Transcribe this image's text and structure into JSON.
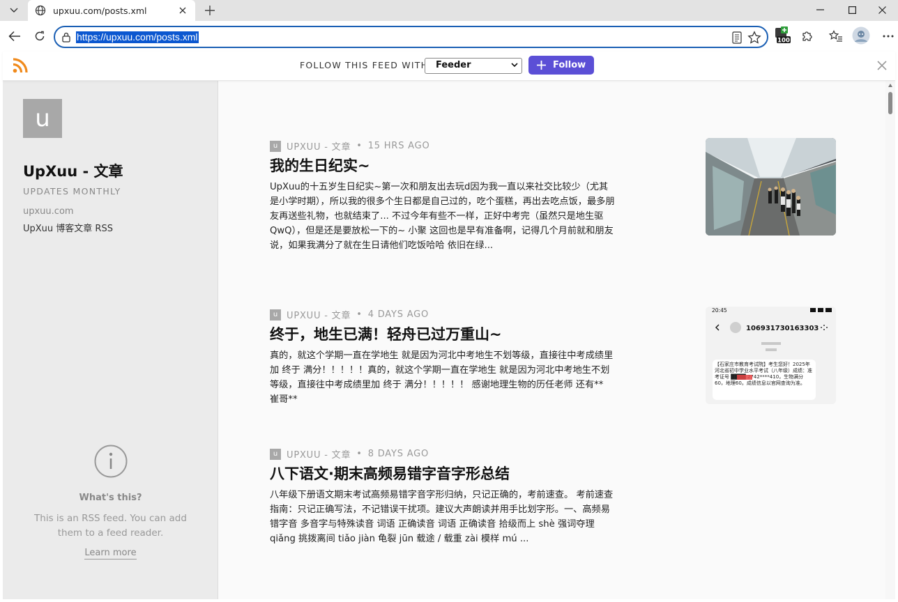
{
  "browser": {
    "tab_title": "upxuu.com/posts.xml",
    "url": "https://upxuu.com/posts.xml",
    "extension_badge": "100"
  },
  "follow_bar": {
    "label": "FOLLOW THIS FEED WITH",
    "selected_reader": "Feeder",
    "follow_label": "Follow",
    "accent": "#5b4fd6"
  },
  "site": {
    "avatar_letter": "u",
    "title": "UpXuu - 文章",
    "updates": "UPDATES MONTHLY",
    "domain": "upxuu.com",
    "description": "UpXuu 博客文章 RSS"
  },
  "info": {
    "icon": "info-icon",
    "title": "What's this?",
    "text": "This is an RSS feed. You can add them to a feed reader.",
    "learn_more": "Learn more"
  },
  "entries": [
    {
      "avatar": "u",
      "source": "UPXUU - 文章",
      "time": "15 HRS AGO",
      "title": "我的生日纪实~",
      "summary": "UpXuu的十五岁生日纪实~第一次和朋友出去玩d因为我一直以来社交比较少（尤其是小学时期），所以我的很多个生日都是自己过的，吃个蛋糕，再出去吃点饭，最多朋友再送些礼物，也就结束了... 不过今年有些不一样，正好中考完（虽然只是地生驱QwQ），但是还是要放松一下的~ 小聚 这回也是早有准备啊，记得几个月前就和朋友说，如果我满分了就在生日请他们吃饭哈哈 依旧在绿..."
    },
    {
      "avatar": "u",
      "source": "UPXUU - 文章",
      "time": "4 DAYS AGO",
      "title": "终于，地生已满！轻舟已过万重山~",
      "summary": "真的，就这个学期一直在学地生 就是因为河北中考地生不划等级，直接往中考成绩里加 终于 满分！！！！！真的，就这个学期一直在学地生 就是因为河北中考地生不划等级，直接往中考成绩里加 终于 满分！！！！！ 感谢地理生物的历任老师 还有** 崔哥**",
      "thumb": {
        "status_time": "20:45",
        "phone_number": "106931730163303",
        "sms_text": "【石家庄市教育考试院】考生您好！2025年河北省初中学业水平考试（八年级）成绩：准考证号 ████ 2742****410，生物满分60，地理60。成绩信息以官网查询为准。"
      }
    },
    {
      "avatar": "u",
      "source": "UPXUU - 文章",
      "time": "8 DAYS AGO",
      "title": "八下语文·期末高频易错字音字形总结",
      "summary": "八年级下册语文期末考试高频易错字音字形归纳，只记正确的，考前速查。 考前速查指南：只记正确写法，不记错误干扰项。建议大声朗读并用手比划字形。一、高频易错字音 多音字与特殊读音 词语 正确读音 词语 正确读音 拾级而上 shè 强词夺理 qiǎng 挑拨离间 tiǎo jiàn 龟裂 jūn 载途 / 载重 zài 模样 mú ..."
    }
  ]
}
